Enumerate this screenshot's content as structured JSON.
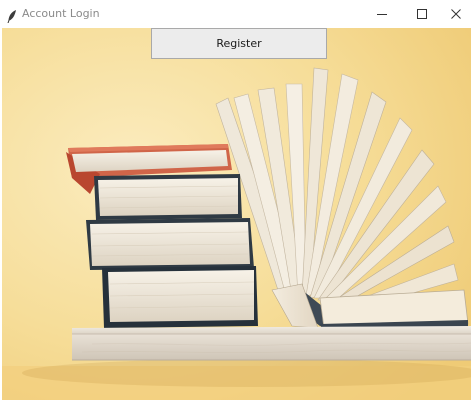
{
  "window": {
    "title": "Account Login",
    "icon": "feather-icon",
    "controls": [
      "minimize-icon",
      "maximize-icon",
      "close-icon"
    ]
  },
  "main": {
    "register_label": "Register",
    "background_image": "books-on-shelf"
  },
  "colors": {
    "wall": "#f6dc96",
    "shelf": "#e6ded3",
    "register_button_bg": "#ececec",
    "red_book": "#c8533b"
  }
}
